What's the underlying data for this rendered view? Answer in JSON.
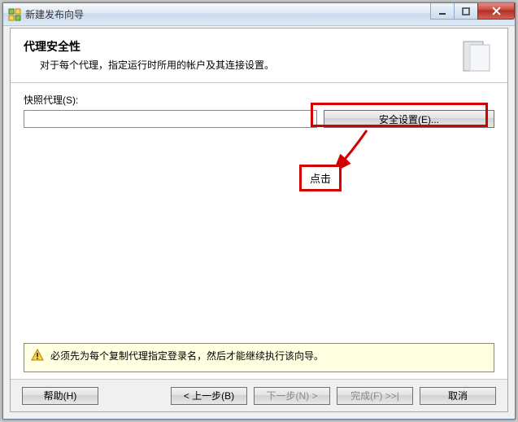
{
  "window": {
    "title": "新建发布向导"
  },
  "header": {
    "heading": "代理安全性",
    "description": "对于每个代理，指定运行时所用的帐户及其连接设置。"
  },
  "form": {
    "snapshot_label": "快照代理(S):",
    "snapshot_value": "",
    "security_button": "安全设置(E)..."
  },
  "annotation": {
    "label": "点击"
  },
  "warning": {
    "text": "必须先为每个复制代理指定登录名，然后才能继续执行该向导。"
  },
  "footer": {
    "help": "帮助(H)",
    "back": "< 上一步(B)",
    "next": "下一步(N) >",
    "finish": "完成(F) >>|",
    "cancel": "取消"
  }
}
